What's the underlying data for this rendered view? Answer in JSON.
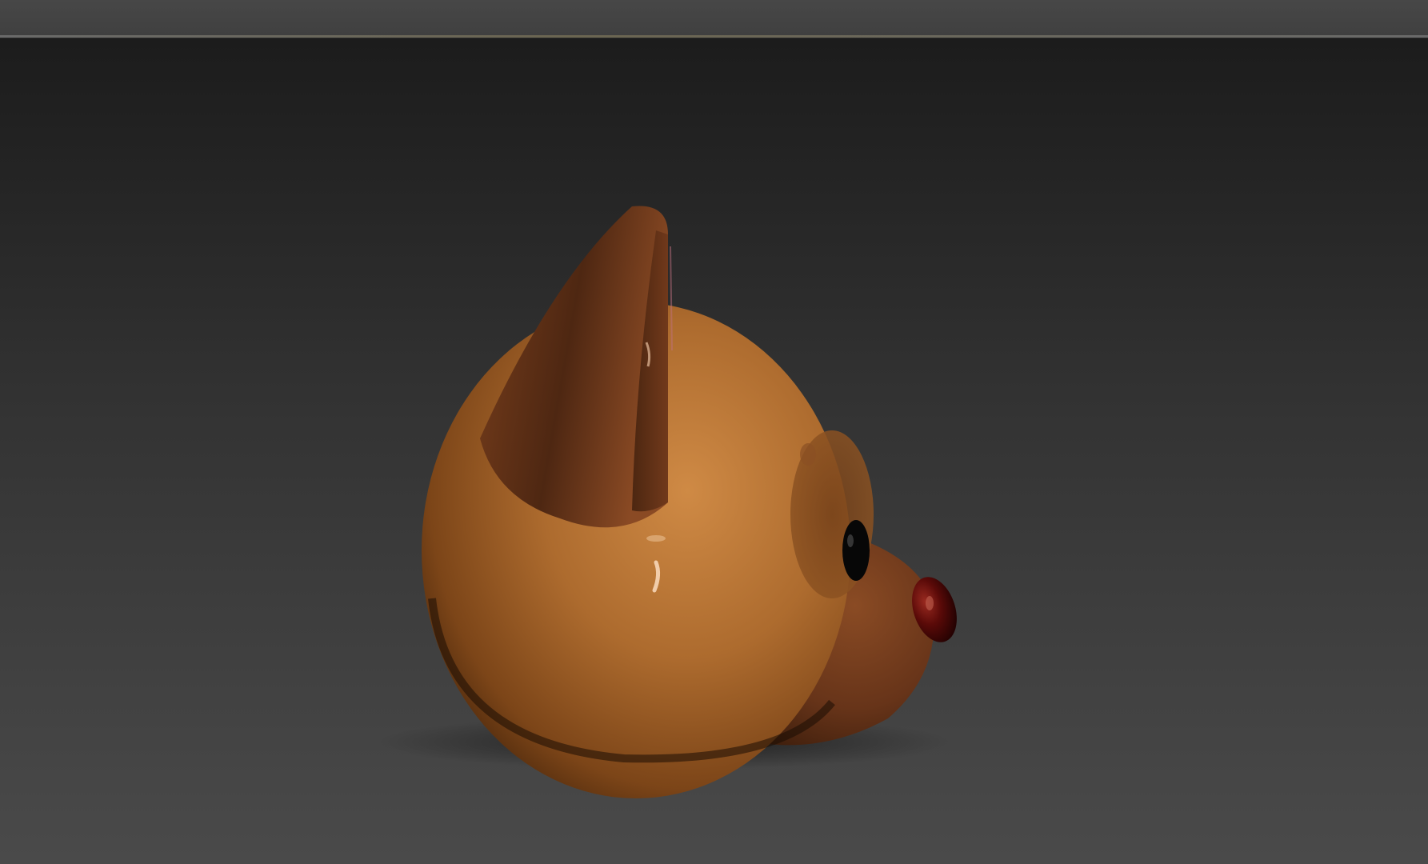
{
  "app": {
    "type": "3d-viewport"
  },
  "viewport": {
    "background_top": "#1c1c1c",
    "background_bottom": "#4a4a4a",
    "model": {
      "name": "cartoon-dog-head",
      "head_color": "#a8692e",
      "ear_color": "#5a2e15",
      "snout_color": "#6e3b1d",
      "nose_color": "#5a0808",
      "eye_color": "#0a0a0a"
    }
  }
}
